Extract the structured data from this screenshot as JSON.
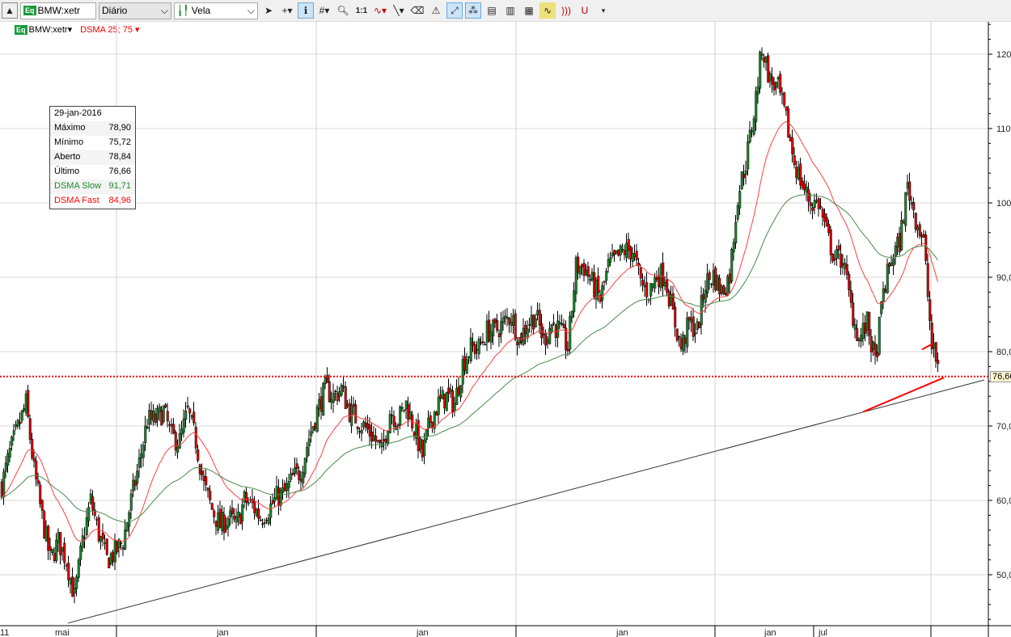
{
  "toolbar": {
    "symbol": "BMW:xetr",
    "period": "Diário",
    "chart_type": "Vela",
    "eq_badge": "Eq",
    "one_to_one": "1:1"
  },
  "legend": {
    "symbol": "BMW:xetr",
    "indicator": "DSMA 25; 75"
  },
  "info": {
    "date": "29-jan-2016",
    "rows": [
      {
        "label": "Máximo",
        "value": "78,90"
      },
      {
        "label": "Mínimo",
        "value": "75,72"
      },
      {
        "label": "Aberto",
        "value": "78,84"
      },
      {
        "label": "Último",
        "value": "76,66"
      }
    ],
    "slow_label": "DSMA Slow",
    "slow_value": "91,71",
    "fast_label": "DSMA Fast",
    "fast_value": "84,96"
  },
  "colors": {
    "up": "#1a8a2a",
    "down": "#e00000",
    "slow": "#4a8a4a",
    "fast": "#ff4040",
    "trend": "#333333"
  },
  "chart_data": {
    "type": "candlestick",
    "y_ticks": [
      "120",
      "110",
      "100",
      "90,0",
      "80,0",
      "70,0",
      "60,0",
      "50,0"
    ],
    "y_tick_values": [
      120,
      110,
      100,
      90,
      80,
      70,
      60,
      50
    ],
    "ylim": [
      43,
      125
    ],
    "x_labels": [
      "11",
      "mai",
      "jan",
      "jan",
      "jan",
      "jan",
      "jul"
    ],
    "last_price": 76.66,
    "last_label": "76,66",
    "closes": [
      62,
      66.4,
      69.7,
      73,
      64,
      57.7,
      52,
      54.5,
      52,
      47,
      54.5,
      60,
      55.5,
      52,
      53,
      54.5,
      60,
      65,
      70.8,
      70.8,
      72,
      68.5,
      68,
      72,
      68,
      62,
      58.8,
      56.6,
      57.7,
      56.6,
      60,
      59.3,
      57.7,
      58.8,
      60.4,
      61,
      63,
      64,
      68.5,
      72,
      75,
      74,
      75,
      72,
      70.8,
      69.7,
      68.5,
      66.4,
      72,
      70.8,
      73,
      69.7,
      66,
      70.8,
      73,
      74,
      73,
      78.4,
      80.5,
      80.5,
      82.8,
      82.8,
      83.8,
      84.9,
      81.6,
      83.8,
      84.9,
      81.6,
      83.8,
      82.8,
      80.5,
      91.4,
      91.4,
      89.2,
      87,
      91.4,
      92.5,
      93.6,
      93.6,
      89.2,
      88,
      90.3,
      90.3,
      84.9,
      80.5,
      83.8,
      82.8,
      89.2,
      90.3,
      88,
      90.3,
      101,
      105.5,
      112,
      121,
      116.4,
      115.3,
      111,
      105.5,
      102.3,
      100,
      100,
      95.8,
      92.5,
      92.5,
      86,
      81.6,
      83.8,
      78.4,
      88,
      92.5,
      94.7,
      102.3,
      98,
      94.7,
      80.5,
      77.3
    ],
    "trendline": {
      "from": [
        8.2,
        43.5
      ],
      "to": [
        121.5,
        76.2
      ]
    },
    "red_lines": [
      {
        "from": [
          106.5,
          71.9
        ],
        "to": [
          116.5,
          76.5
        ]
      },
      {
        "from": [
          113.8,
          80.3
        ],
        "to": [
          115.2,
          81.1
        ]
      }
    ]
  }
}
